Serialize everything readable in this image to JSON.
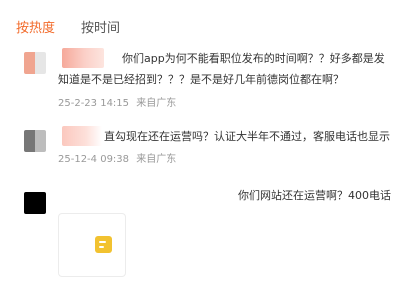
{
  "tabs": {
    "hot": "按热度",
    "time": "按时间"
  },
  "comments": [
    {
      "text_line1": "你们app为何不能看职位发布的时间啊？？好多都是发",
      "text_line2": "知道是不是已经招到？？？是不是好几年前德岗位都在啊？",
      "date": "25-2-23 14:15",
      "location": "来自广东"
    },
    {
      "text_line1": "直勾现在还在运营吗？认证大半年不通过，客服电话也显示",
      "date": "25-12-4 09:38",
      "location": "来自广东"
    },
    {
      "text_line1": "你们网站还在运营啊？400电话"
    }
  ],
  "colors": {
    "accent": "#f26b2b",
    "avatar1_left": "#f0a590",
    "avatar1_right": "#e6e6e6",
    "avatar2_left": "#777777",
    "avatar2_right": "#bdbdbd",
    "avatar3": "#000000",
    "thumb_icon": "#f2c230"
  },
  "icons": {
    "thumb": "notes-app-icon"
  }
}
